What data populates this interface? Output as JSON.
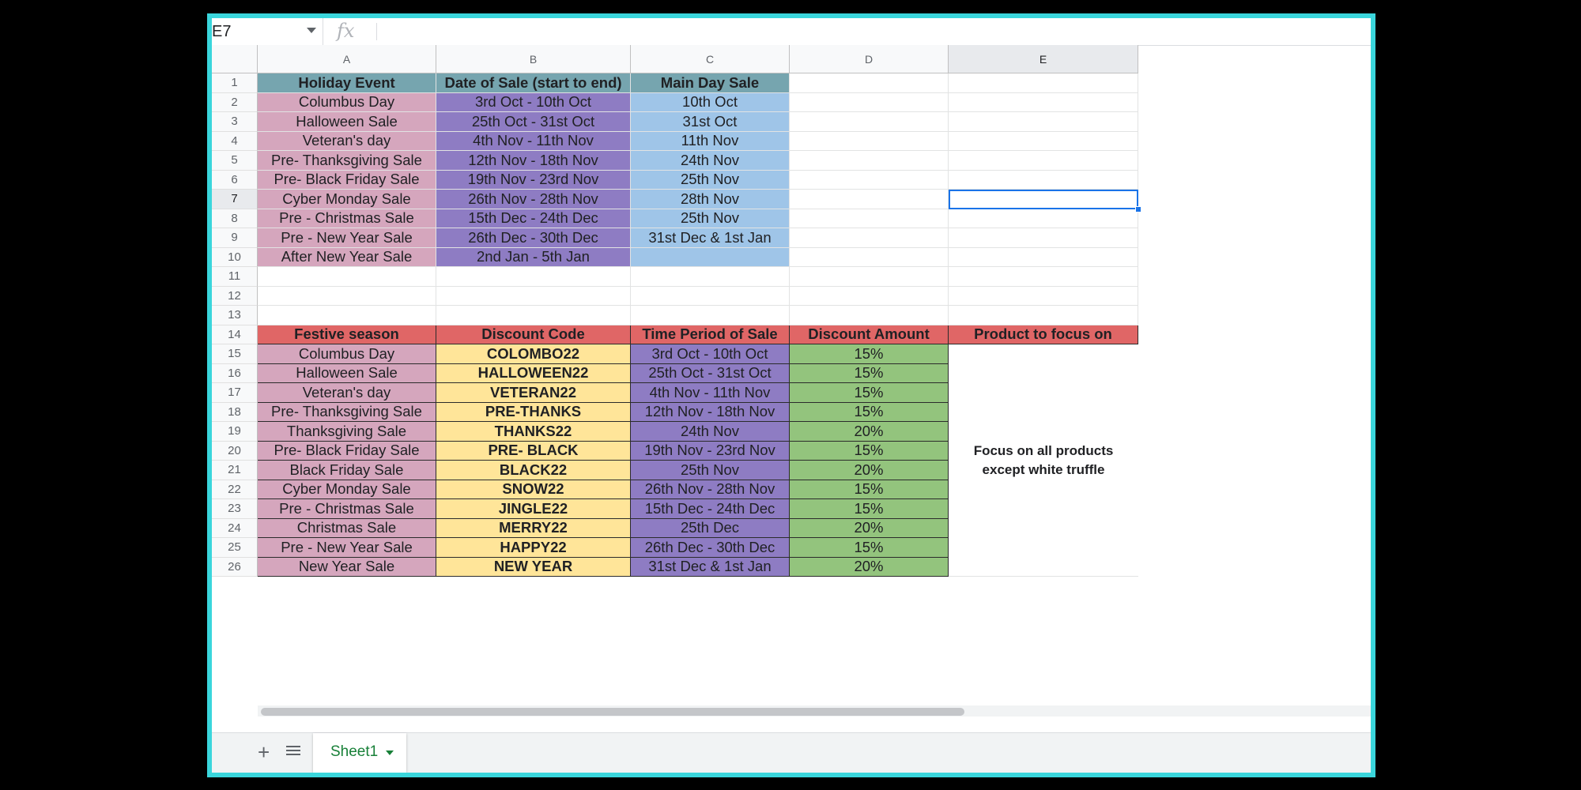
{
  "formula_bar": {
    "name_box": "E7",
    "fx_label": "fx",
    "formula": ""
  },
  "columns": [
    "A",
    "B",
    "C",
    "D",
    "E"
  ],
  "selected_cell": "E7",
  "rows": [
    [
      "Holiday Event",
      "Date of Sale (start to end)",
      "Main Day Sale",
      "",
      ""
    ],
    [
      "Columbus Day",
      "3rd Oct - 10th Oct",
      "10th Oct",
      "",
      ""
    ],
    [
      "Halloween Sale",
      "25th Oct - 31st Oct",
      "31st Oct",
      "",
      ""
    ],
    [
      "Veteran's day",
      "4th Nov - 11th Nov",
      "11th Nov",
      "",
      ""
    ],
    [
      "Pre- Thanksgiving Sale",
      "12th Nov - 18th Nov",
      "24th Nov",
      "",
      ""
    ],
    [
      "Pre- Black Friday Sale",
      "19th Nov - 23rd Nov",
      "25th Nov",
      "",
      ""
    ],
    [
      "Cyber Monday Sale",
      "26th Nov - 28th Nov",
      "28th Nov",
      "",
      ""
    ],
    [
      "Pre - Christmas Sale",
      "15th Dec - 24th Dec",
      "25th Nov",
      "",
      ""
    ],
    [
      "Pre - New Year Sale",
      "26th Dec - 30th Dec",
      "31st Dec & 1st Jan",
      "",
      ""
    ],
    [
      "After New Year Sale",
      "2nd Jan - 5th Jan",
      "",
      "",
      ""
    ],
    [
      "",
      "",
      "",
      "",
      ""
    ],
    [
      "",
      "",
      "",
      "",
      ""
    ],
    [
      "",
      "",
      "",
      "",
      ""
    ],
    [
      "Festive season",
      "Discount Code",
      "Time Period of Sale",
      "Discount Amount",
      "Product to focus on"
    ],
    [
      "Columbus Day",
      "COLOMBO22",
      "3rd Oct - 10th Oct",
      "15%",
      ""
    ],
    [
      "Halloween Sale",
      "HALLOWEEN22",
      "25th Oct - 31st Oct",
      "15%",
      ""
    ],
    [
      "Veteran's day",
      "VETERAN22",
      "4th Nov - 11th Nov",
      "15%",
      ""
    ],
    [
      "Pre- Thanksgiving Sale",
      "PRE-THANKS",
      "12th Nov - 18th Nov",
      "15%",
      ""
    ],
    [
      "Thanksgiving Sale",
      "THANKS22",
      "24th Nov",
      "20%",
      ""
    ],
    [
      "Pre- Black Friday Sale",
      "PRE- BLACK",
      "19th Nov - 23rd Nov",
      "15%",
      ""
    ],
    [
      "Black Friday Sale",
      "BLACK22",
      "25th Nov",
      "20%",
      ""
    ],
    [
      "Cyber Monday Sale",
      "SNOW22",
      "26th Nov - 28th Nov",
      "15%",
      ""
    ],
    [
      "Pre - Christmas Sale",
      "JINGLE22",
      "15th Dec - 24th Dec",
      "15%",
      ""
    ],
    [
      "Christmas Sale",
      "MERRY22",
      "25th Dec",
      "20%",
      ""
    ],
    [
      "Pre - New Year Sale",
      "HAPPY22",
      "26th Dec - 30th Dec",
      "15%",
      ""
    ],
    [
      "New Year Sale",
      "NEW YEAR",
      "31st Dec & 1st Jan",
      "20%",
      ""
    ]
  ],
  "merged_note": "Focus on all products\nexcept white truffle",
  "colors": {
    "pink": "#d5a6bd",
    "purple": "#8e7cc3",
    "light_blue": "#9fc5e8",
    "teal": "#76a5af",
    "red": "#e06666",
    "yellow": "#ffe599",
    "green": "#93c47d",
    "frame": "#3ad6dc",
    "selection": "#1a73e8"
  },
  "tab_bar": {
    "add_icon": "plus-icon",
    "list_icon": "list-icon",
    "active_sheet": "Sheet1"
  }
}
